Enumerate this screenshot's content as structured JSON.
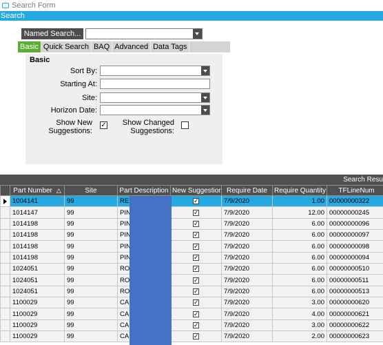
{
  "window": {
    "title": "Search Form"
  },
  "header": {
    "label": "Search"
  },
  "named_search": {
    "button_label": "Named Search...",
    "value": ""
  },
  "tabs": [
    {
      "label": "Basic",
      "active": true
    },
    {
      "label": "Quick Search",
      "active": false
    },
    {
      "label": "BAQ",
      "active": false
    },
    {
      "label": "Advanced",
      "active": false
    },
    {
      "label": "Data Tags",
      "active": false
    }
  ],
  "basic": {
    "title": "Basic",
    "sort_by_label": "Sort By:",
    "sort_by_value": "",
    "starting_at_label": "Starting At:",
    "starting_at_value": "",
    "site_label": "Site:",
    "site_value": "",
    "horizon_date_label": "Horizon Date:",
    "horizon_date_value": "",
    "show_new_label_1": "Show New",
    "show_new_label_2": "Suggestions:",
    "show_new_checked": true,
    "show_changed_label_1": "Show Changed",
    "show_changed_label_2": "Suggestions:",
    "show_changed_checked": false
  },
  "results": {
    "title": "Search Resu",
    "columns": [
      "Part Number",
      "Site",
      "Part Description",
      "New Suggestion",
      "Require Date",
      "Require Quantity",
      "TFLineNum"
    ],
    "rows": [
      {
        "part": "1004141",
        "site": "99",
        "desc": "RE",
        "new": true,
        "date": "7/9/2020",
        "qty": "1.00",
        "tf": "00000000322"
      },
      {
        "part": "1014147",
        "site": "99",
        "desc": "PIN",
        "new": true,
        "date": "7/9/2020",
        "qty": "12.00",
        "tf": "00000000245"
      },
      {
        "part": "1014198",
        "site": "99",
        "desc": "PIN",
        "new": true,
        "date": "7/9/2020",
        "qty": "6.00",
        "tf": "00000000096"
      },
      {
        "part": "1014198",
        "site": "99",
        "desc": "PIN",
        "new": true,
        "date": "7/9/2020",
        "qty": "6.00",
        "tf": "00000000097"
      },
      {
        "part": "1014198",
        "site": "99",
        "desc": "PIN",
        "new": true,
        "date": "7/9/2020",
        "qty": "6.00",
        "tf": "00000000098"
      },
      {
        "part": "1014198",
        "site": "99",
        "desc": "PIN",
        "new": true,
        "date": "7/9/2020",
        "qty": "6.00",
        "tf": "00000000094"
      },
      {
        "part": "1024051",
        "site": "99",
        "desc": "RO",
        "new": true,
        "date": "7/9/2020",
        "qty": "6.00",
        "tf": "00000000510"
      },
      {
        "part": "1024051",
        "site": "99",
        "desc": "RO",
        "new": true,
        "date": "7/9/2020",
        "qty": "6.00",
        "tf": "00000000511"
      },
      {
        "part": "1024051",
        "site": "99",
        "desc": "RO",
        "new": true,
        "date": "7/9/2020",
        "qty": "6.00",
        "tf": "00000000513"
      },
      {
        "part": "1100029",
        "site": "99",
        "desc": "CA",
        "new": true,
        "date": "7/9/2020",
        "qty": "3.00",
        "tf": "00000000620"
      },
      {
        "part": "1100029",
        "site": "99",
        "desc": "CA",
        "new": true,
        "date": "7/9/2020",
        "qty": "4.00",
        "tf": "00000000621"
      },
      {
        "part": "1100029",
        "site": "99",
        "desc": "CA",
        "new": true,
        "date": "7/9/2020",
        "qty": "3.00",
        "tf": "00000000622"
      },
      {
        "part": "1100029",
        "site": "99",
        "desc": "CA",
        "new": true,
        "date": "7/9/2020",
        "qty": "2.00",
        "tf": "00000000623"
      }
    ]
  },
  "colors": {
    "accent_blue": "#26a9e0",
    "tab_active": "#5aae32",
    "dark_bar": "#505050",
    "redaction": "#4472c4"
  }
}
